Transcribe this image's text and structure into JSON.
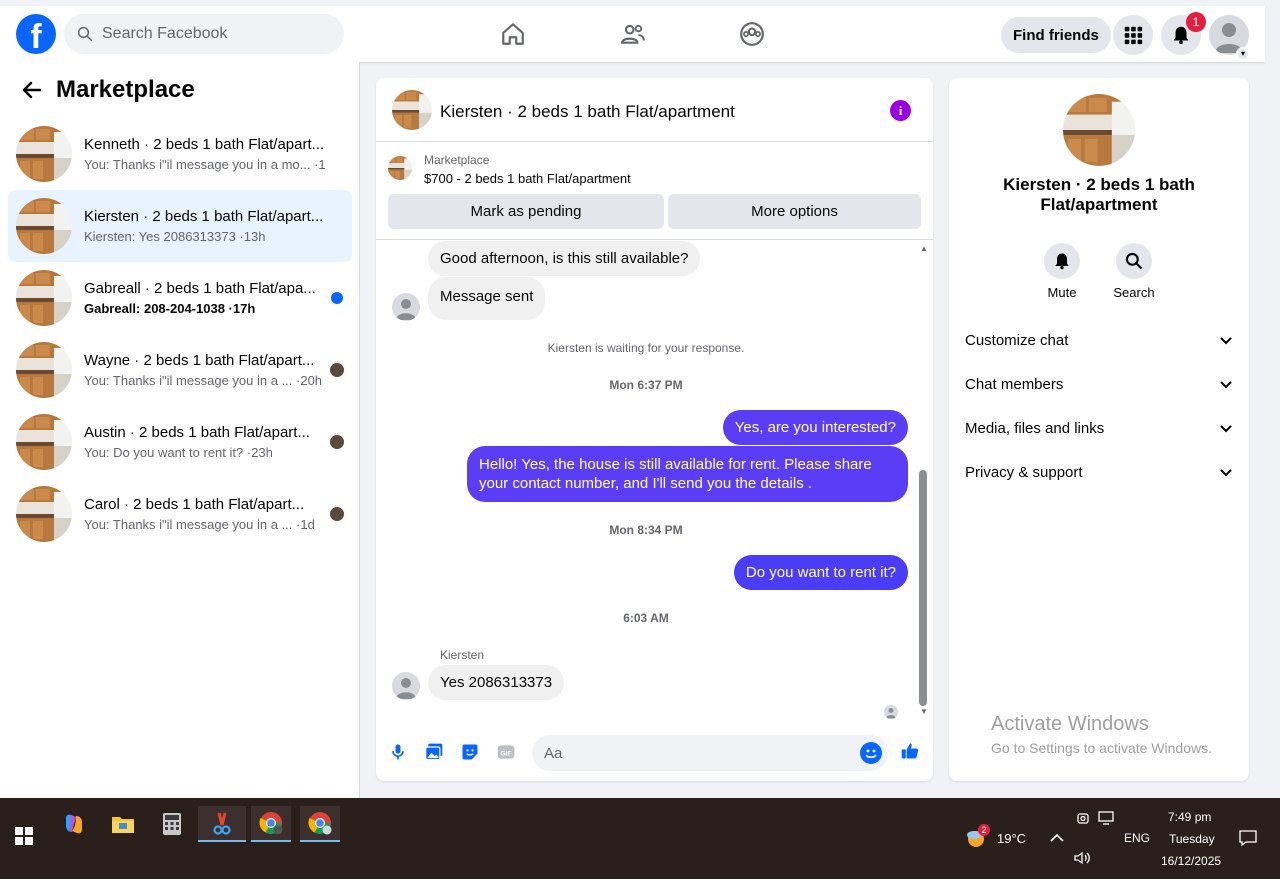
{
  "topbar": {
    "search_placeholder": "Search Facebook",
    "find_friends": "Find friends",
    "notification_count": "1",
    "logo": "f"
  },
  "sidebar": {
    "title": "Marketplace",
    "conversations": [
      {
        "title": "Kenneth · 2 beds 1 bath Flat/apart...",
        "sub": "You: Thanks i\"il message you in a mo... ·1m",
        "active": false,
        "unread": false
      },
      {
        "title": "Kiersten · 2 beds 1 bath Flat/apart...",
        "sub": "Kiersten: Yes 2086313373 ·13h",
        "active": true,
        "unread": false
      },
      {
        "title": "Gabreall · 2 beds 1 bath Flat/apa...",
        "sub": "Gabreall: 208-204-1038 ·17h",
        "active": false,
        "unread": true
      },
      {
        "title": "Wayne · 2 beds 1 bath Flat/apart...",
        "sub": "You: Thanks i\"il message you in a ... ·20h",
        "active": false,
        "unread": false
      },
      {
        "title": "Austin · 2 beds 1 bath Flat/apart...",
        "sub": "You: Do you want to rent it? ·23h",
        "active": false,
        "unread": false
      },
      {
        "title": "Carol · 2 beds 1 bath Flat/apart...",
        "sub": "You: Thanks i\"il message you in a ...   ·1d",
        "active": false,
        "unread": false
      }
    ]
  },
  "chat": {
    "title": "Kiersten · 2 beds 1 bath Flat/apartment",
    "info_glyph": "i",
    "listing_source": "Marketplace",
    "listing_price": "$700 - 2 beds 1 bath Flat/apartment",
    "mark_pending": "Mark as pending",
    "more_options": "More options",
    "messages": {
      "m1": "Good afternoon, is this still available?",
      "m2": "Message sent",
      "waiting": "Kiersten is waiting for your response.",
      "t1": "Mon 6:37 PM",
      "m3": "Yes, are you interested?",
      "m4": "Hello! Yes, the house is still available for rent. Please share your contact number, and I'll send you the details .",
      "t2": "Mon 8:34 PM",
      "m5": "Do you want to rent it?",
      "t3": "6:03 AM",
      "sender": "Kiersten",
      "m6": "Yes 2086313373"
    },
    "input_placeholder": "Aa",
    "gif_label": "GIF"
  },
  "info_panel": {
    "title": "Kiersten · 2 beds 1 bath Flat/apartment",
    "mute": "Mute",
    "search": "Search",
    "rows": [
      "Customize chat",
      "Chat members",
      "Media, files and links",
      "Privacy & support"
    ]
  },
  "watermark": {
    "line1": "Activate Windows",
    "line2": "Go to Settings to activate Windows."
  },
  "taskbar": {
    "weather_temp": "19°C",
    "weather_badge": "2",
    "lang": "ENG",
    "time": "7:49 pm",
    "day": "Tuesday",
    "date": "16/12/2025"
  },
  "colors": {
    "brand": "#0866ff",
    "outgoing_bubble": "#5b3df5",
    "info_icon": "#9a00e6",
    "taskbar": "#2b1f1c"
  }
}
